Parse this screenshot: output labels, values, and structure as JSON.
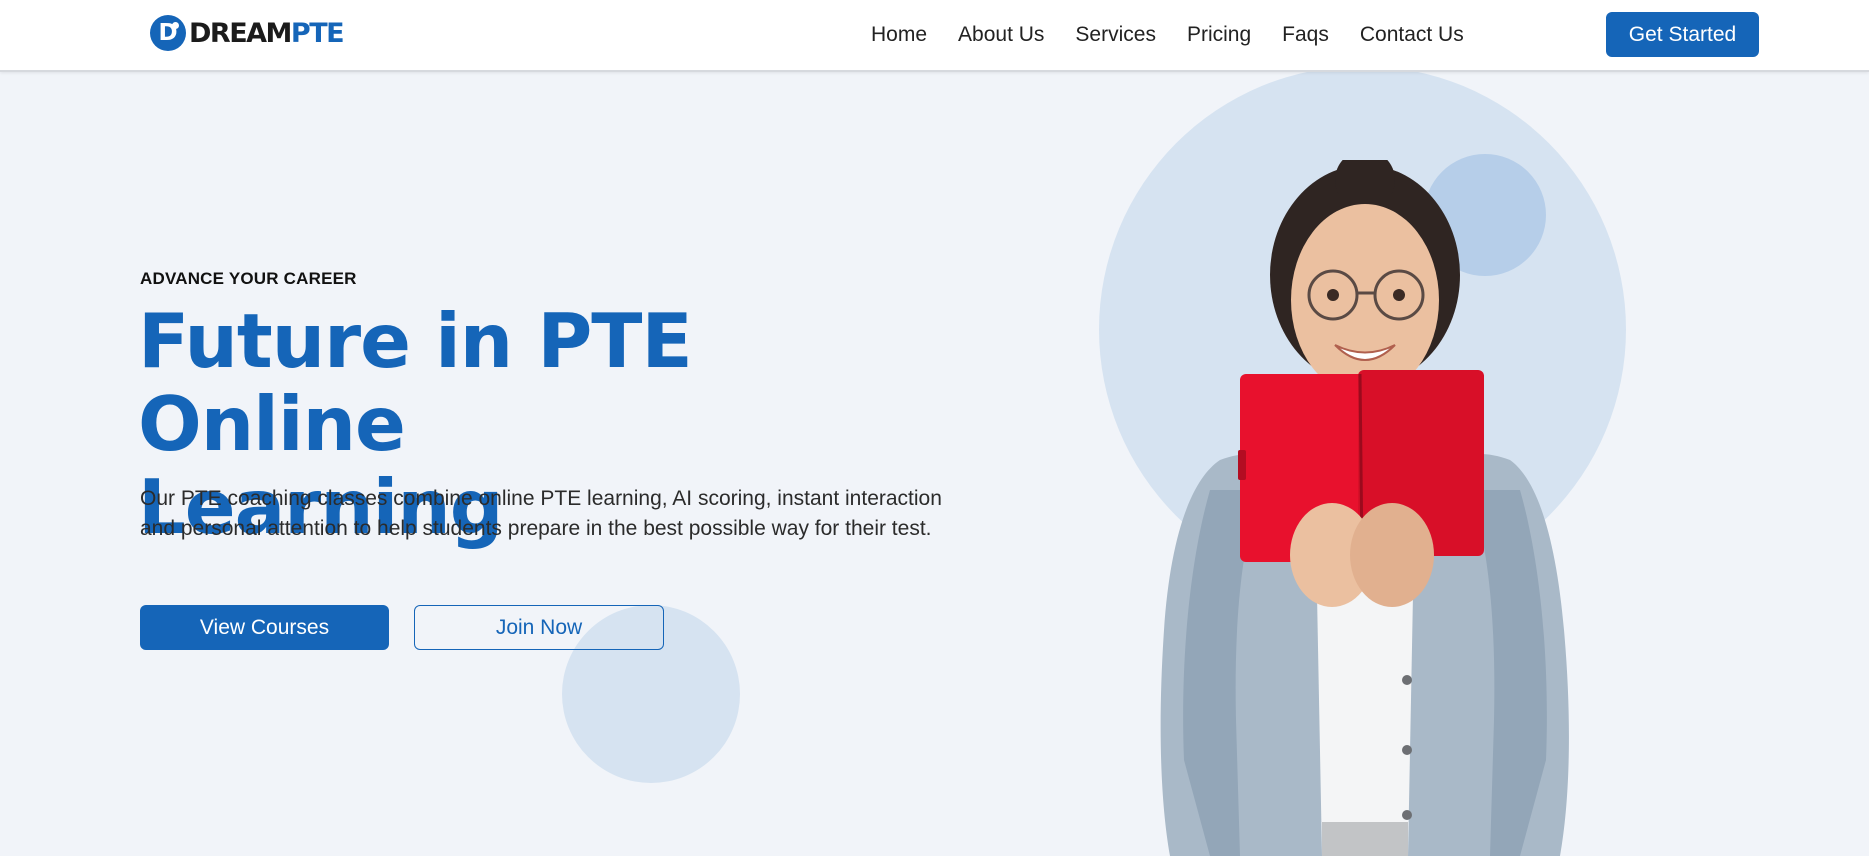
{
  "brand": {
    "mark_letter": "D",
    "name_part1": "DREAM",
    "name_part2": "PTE"
  },
  "nav": {
    "items": [
      "Home",
      "About Us",
      "Services",
      "Pricing",
      "Faqs",
      "Contact Us"
    ]
  },
  "header": {
    "cta_label": "Get Started"
  },
  "hero": {
    "eyebrow": "ADVANCE YOUR CAREER",
    "title_line1": "Future in PTE Online",
    "title_line2": "Learning",
    "description": "Our PTE coaching classes combine online PTE learning, AI scoring, instant interaction and personal attention to help students prepare in the best possible way for their test.",
    "primary_button": "View Courses",
    "secondary_button": "Join Now"
  },
  "colors": {
    "brand_blue": "#1565b8",
    "page_background": "#f1f4f9",
    "circle_light": "#d6e3f1",
    "book_red": "#e8112d"
  },
  "icons": {
    "logo": "circle-d-logo-icon"
  }
}
